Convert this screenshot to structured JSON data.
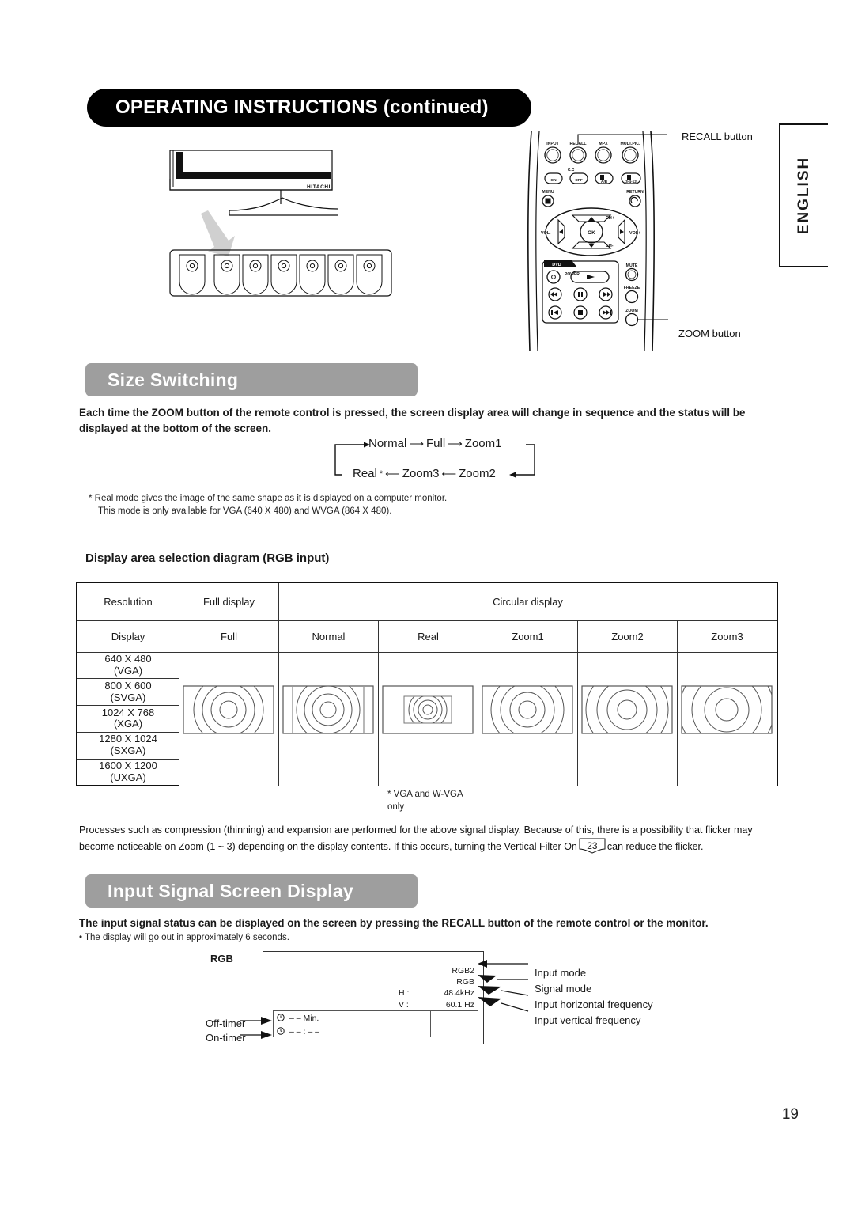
{
  "header": {
    "title": "OPERATING INSTRUCTIONS (continued)"
  },
  "language_tab": {
    "label": "ENGLISH"
  },
  "monitor": {
    "brand": "HITACHI",
    "button_count": 7
  },
  "remote": {
    "top_buttons": [
      "INPUT",
      "RECALL",
      "MPX",
      "MULT.PIC."
    ],
    "cc_label": "C.C",
    "cc_buttons": [
      "ON",
      "OFF",
      "A/B",
      "3-4-12"
    ],
    "menu_label": "MENU",
    "return_label": "RETURN",
    "dpad": {
      "up": "CH+",
      "down": "CH-",
      "left": "VOL-",
      "right": "VOL+",
      "center": "OK"
    },
    "dvd_label": "DVD",
    "power_label": "POWER",
    "side_buttons": [
      "MUTE",
      "FREEZE",
      "ZOOM"
    ]
  },
  "callouts": {
    "recall": "RECALL button",
    "zoom": "ZOOM button"
  },
  "size_switching": {
    "pill_title": "Size Switching",
    "intro": "Each time the ZOOM button of the remote control is pressed, the screen display area will change in sequence and the status will be displayed at the bottom of the screen.",
    "sequence_top": [
      "Normal",
      "Full",
      "Zoom1"
    ],
    "sequence_bottom": [
      "Real",
      "Zoom3",
      "Zoom2"
    ],
    "footnote_line1": "* Real mode gives the image of the same shape as it is displayed on a computer monitor.",
    "footnote_line2": "This mode is only available for VGA (640 X 480) and WVGA (864 X 480)."
  },
  "table": {
    "heading": "Display area selection diagram (RGB input)",
    "group_headers": [
      "Resolution",
      "Full display",
      "Circular display"
    ],
    "column_headers": [
      "Display",
      "Full",
      "Normal",
      "Real",
      "Zoom1",
      "Zoom2",
      "Zoom3"
    ],
    "resolutions": [
      {
        "res": "640 X 480",
        "name": "(VGA)"
      },
      {
        "res": "800 X 600",
        "name": "(SVGA)"
      },
      {
        "res": "1024 X 768",
        "name": "(XGA)"
      },
      {
        "res": "1280 X 1024",
        "name": "(SXGA)"
      },
      {
        "res": "1600 X 1200",
        "name": "(UXGA)"
      }
    ],
    "real_note_line1": "* VGA and W-VGA",
    "real_note_line2": "only"
  },
  "after_table": {
    "text_part1": "Processes such as compression (thinning) and expansion are performed for the above signal display. Because of this, there is a possibility that flicker may become noticeable on Zoom (1 ~ 3) depending on the display contents. If this occurs, turning the Vertical Filter On",
    "page_ref": "23",
    "text_part2": "can reduce the flicker."
  },
  "input_signal": {
    "pill_title": "Input Signal Screen Display",
    "intro": "The input signal status can be displayed on the screen by pressing the RECALL button of the remote control or the monitor.",
    "bullet": "• The display will go out in approximately 6 seconds.",
    "diagram_label": "RGB",
    "osd": {
      "input_mode": "RGB2",
      "signal_mode": "RGB",
      "h_label": "H :",
      "h_value": "48.4kHz",
      "v_label": "V :",
      "v_value": "60.1 Hz"
    },
    "timers": {
      "off_value": "– – Min.",
      "on_value": "– – : – –"
    },
    "callouts": {
      "input_mode": "Input mode",
      "signal_mode": "Signal mode",
      "h_freq": "Input horizontal frequency",
      "v_freq": "Input vertical frequency",
      "off_timer": "Off-timer",
      "on_timer": "On-timer"
    }
  },
  "page_number": "19",
  "colors": {
    "banner_bg": "#000000",
    "pill_bg": "#9e9e9e",
    "text": "#1a1a1a"
  }
}
